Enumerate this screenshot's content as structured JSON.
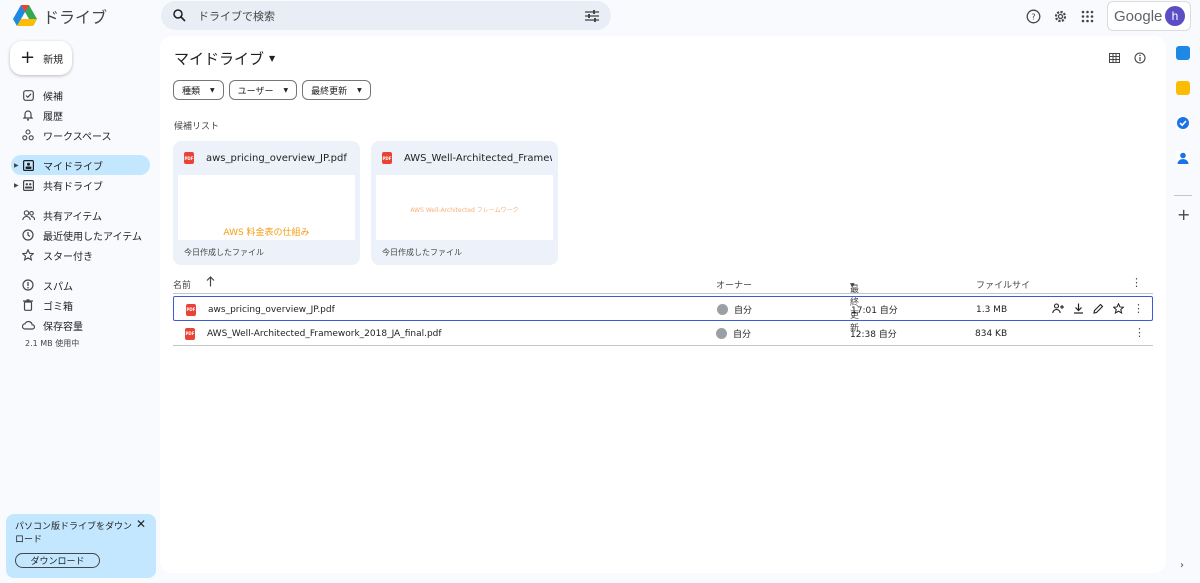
{
  "app": {
    "name": "ドライブ"
  },
  "search": {
    "placeholder": "ドライブで検索"
  },
  "account": {
    "brand": "Google",
    "avatar_letter": "h"
  },
  "sidebar": {
    "new_label": "新規",
    "items": [
      {
        "label": "候補",
        "icon": "check-box-icon"
      },
      {
        "label": "履歴",
        "icon": "bell-icon"
      },
      {
        "label": "ワークスペース",
        "icon": "workspace-icon"
      },
      {
        "label": "マイドライブ",
        "icon": "my-drive-icon",
        "active": true
      },
      {
        "label": "共有ドライブ",
        "icon": "shared-drive-icon"
      },
      {
        "label": "共有アイテム",
        "icon": "people-icon"
      },
      {
        "label": "最近使用したアイテム",
        "icon": "clock-icon"
      },
      {
        "label": "スター付き",
        "icon": "star-icon"
      },
      {
        "label": "スパム",
        "icon": "spam-icon"
      },
      {
        "label": "ゴミ箱",
        "icon": "trash-icon"
      },
      {
        "label": "保存容量",
        "icon": "cloud-icon"
      }
    ],
    "storage_used": "2.1 MB 使用中",
    "promo": {
      "text": "パソコン版ドライブをダウンロード",
      "button": "ダウンロード"
    }
  },
  "main": {
    "title": "マイドライブ",
    "filters": [
      "種類",
      "ユーザー",
      "最終更新"
    ],
    "suggested_label": "候補リスト",
    "cards": [
      {
        "name": "aws_pricing_overview_JP.pdf",
        "thumb_text": "AWS 料金表の仕組み",
        "subtitle": "今日作成したファイル"
      },
      {
        "name": "AWS_Well-Architected_Framewo...",
        "thumb_text": "AWS Well-Architected フレームワーク",
        "subtitle": "今日作成したファイル"
      }
    ],
    "table": {
      "headers": {
        "name": "名前",
        "owner": "オーナー",
        "modified": "最終更新",
        "size": "ファイルサイ"
      },
      "rows": [
        {
          "name": "aws_pricing_overview_JP.pdf",
          "owner": "自分",
          "modified": "17:01 自分",
          "size": "1.3 MB"
        },
        {
          "name": "AWS_Well-Architected_Framework_2018_JA_final.pdf",
          "owner": "自分",
          "modified": "12:38 自分",
          "size": "834 KB"
        }
      ]
    }
  },
  "colors": {
    "accent": "#c2e7ff",
    "search_bg": "#e9eef6",
    "pdf": "#ea4335",
    "selection": "#3b5bdb"
  }
}
